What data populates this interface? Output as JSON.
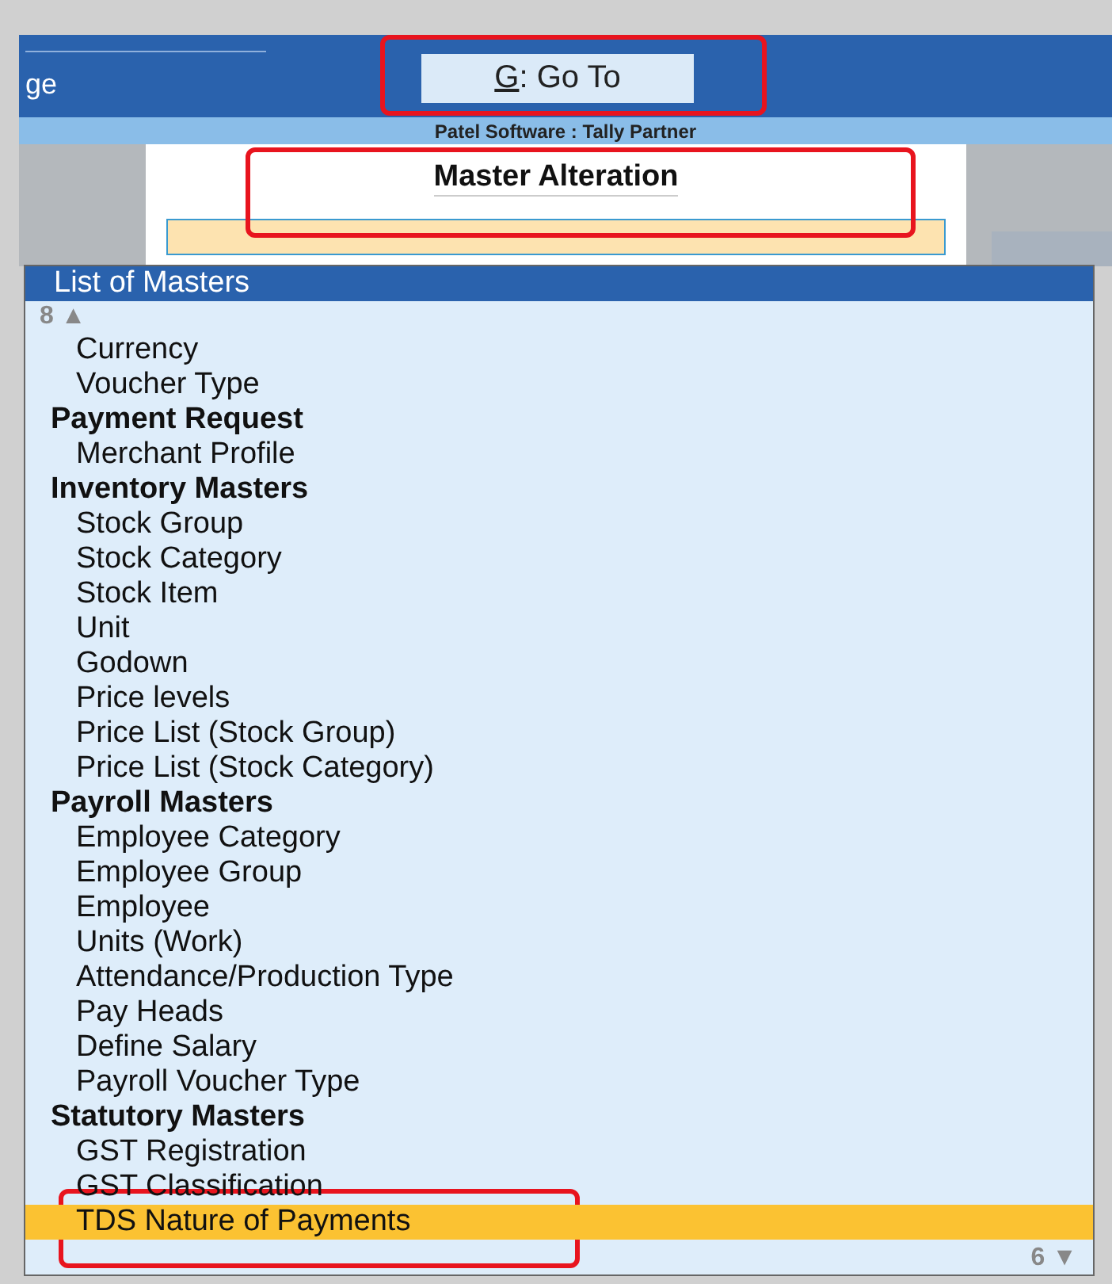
{
  "top_bar": {
    "left_text": "ge",
    "goto_button": {
      "key": "G",
      "separator": ":",
      "label": "Go To"
    }
  },
  "company_strip": "Patel Software : Tally Partner",
  "panel": {
    "title": "Master Alteration"
  },
  "list": {
    "title": "List of Masters",
    "more_above": "8",
    "arrow_above": "▲",
    "more_below": "6",
    "arrow_below": "▼",
    "items": [
      {
        "kind": "item",
        "label": "Currency",
        "selected": false
      },
      {
        "kind": "item",
        "label": "Voucher Type",
        "selected": false
      },
      {
        "kind": "header",
        "label": "Payment Request",
        "selected": false
      },
      {
        "kind": "item",
        "label": "Merchant Profile",
        "selected": false
      },
      {
        "kind": "header",
        "label": "Inventory Masters",
        "selected": false
      },
      {
        "kind": "item",
        "label": "Stock Group",
        "selected": false
      },
      {
        "kind": "item",
        "label": "Stock Category",
        "selected": false
      },
      {
        "kind": "item",
        "label": "Stock Item",
        "selected": false
      },
      {
        "kind": "item",
        "label": "Unit",
        "selected": false
      },
      {
        "kind": "item",
        "label": "Godown",
        "selected": false
      },
      {
        "kind": "item",
        "label": "Price levels",
        "selected": false
      },
      {
        "kind": "item",
        "label": "Price List (Stock Group)",
        "selected": false
      },
      {
        "kind": "item",
        "label": "Price List (Stock Category)",
        "selected": false
      },
      {
        "kind": "header",
        "label": "Payroll Masters",
        "selected": false
      },
      {
        "kind": "item",
        "label": "Employee Category",
        "selected": false
      },
      {
        "kind": "item",
        "label": "Employee Group",
        "selected": false
      },
      {
        "kind": "item",
        "label": "Employee",
        "selected": false
      },
      {
        "kind": "item",
        "label": "Units (Work)",
        "selected": false
      },
      {
        "kind": "item",
        "label": "Attendance/Production Type",
        "selected": false
      },
      {
        "kind": "item",
        "label": "Pay Heads",
        "selected": false
      },
      {
        "kind": "item",
        "label": "Define Salary",
        "selected": false
      },
      {
        "kind": "item",
        "label": "Payroll Voucher Type",
        "selected": false
      },
      {
        "kind": "header",
        "label": "Statutory Masters",
        "selected": false
      },
      {
        "kind": "item",
        "label": "GST Registration",
        "selected": false
      },
      {
        "kind": "item",
        "label": "GST Classification",
        "selected": false
      },
      {
        "kind": "item",
        "label": "TDS Nature of Payments",
        "selected": true
      }
    ]
  }
}
